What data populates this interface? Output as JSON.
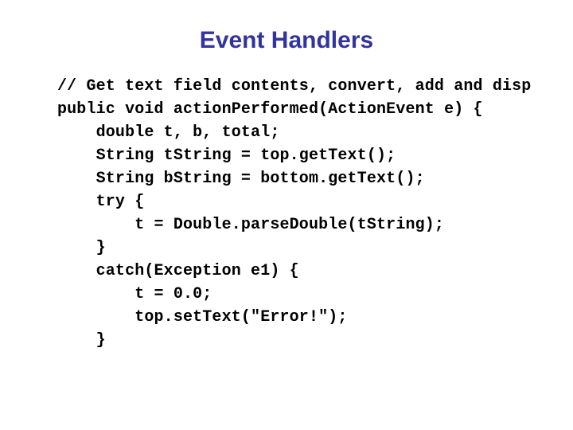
{
  "slide": {
    "title": "Event Handlers",
    "title_color": "#3333A0",
    "background_color": "#FFFFFF",
    "code_color": "#000000"
  },
  "code": {
    "language": "java",
    "lines": [
      "// Get text field contents, convert, add and disp",
      "public void actionPerformed(ActionEvent e) {",
      "    double t, b, total;",
      "    String tString = top.getText();",
      "    String bString = bottom.getText();",
      "    try {",
      "        t = Double.parseDouble(tString);",
      "    }",
      "    catch(Exception e1) {",
      "        t = 0.0;",
      "        top.setText(\"Error!\");",
      "    }"
    ]
  }
}
